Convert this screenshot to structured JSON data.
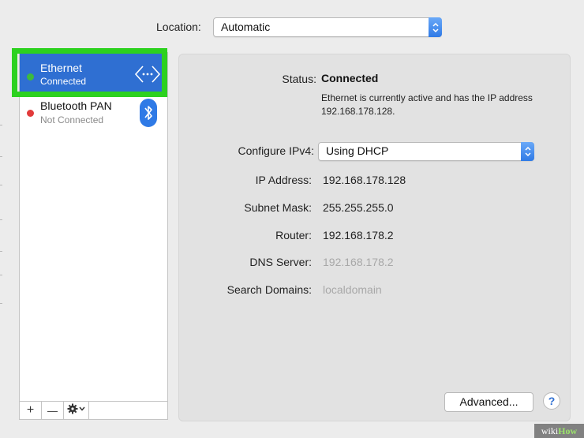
{
  "location": {
    "label": "Location:",
    "value": "Automatic"
  },
  "services": [
    {
      "name": "Ethernet",
      "status": "Connected",
      "status_color": "#3dbb3d",
      "icon": "ethernet-arrows-icon",
      "selected": true
    },
    {
      "name": "Bluetooth PAN",
      "status": "Not Connected",
      "status_color": "#e23b3b",
      "icon": "bluetooth-icon",
      "selected": false
    }
  ],
  "toolbar": {
    "add": "+",
    "remove": "—",
    "actions_icon": "gear-icon"
  },
  "detail": {
    "status_label": "Status:",
    "status_value": "Connected",
    "status_description": "Ethernet is currently active and has the IP address 192.168.178.128.",
    "configure_label": "Configure IPv4:",
    "configure_value": "Using DHCP",
    "ip_label": "IP Address:",
    "ip_value": "192.168.178.128",
    "subnet_label": "Subnet Mask:",
    "subnet_value": "255.255.255.0",
    "router_label": "Router:",
    "router_value": "192.168.178.2",
    "dns_label": "DNS Server:",
    "dns_value": "192.168.178.2",
    "search_label": "Search Domains:",
    "search_value": "localdomain"
  },
  "buttons": {
    "advanced": "Advanced...",
    "help": "?"
  },
  "watermark": {
    "prefix": "wiki",
    "suffix": "How"
  },
  "colors": {
    "selection": "#2f6fd2",
    "highlight_box": "#2cd11f"
  }
}
